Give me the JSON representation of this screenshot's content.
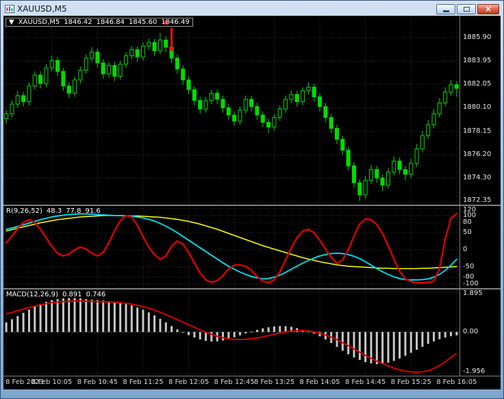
{
  "window": {
    "title": "XAUUSD,M5",
    "buttons": {
      "close_glyph": "×"
    }
  },
  "main_panel": {
    "collapse_arrow": "▼",
    "symbol": "XAUUSD,M5",
    "open": "1846.42",
    "high": "1846.84",
    "low": "1845.60",
    "close": "1846.49"
  },
  "oscillator_panel": {
    "label": "R(9,26,52)",
    "value1": "48.3",
    "value2": "77.8",
    "value3": "91.6"
  },
  "macd_panel": {
    "label": "MACD(12,26,9)",
    "value_main": "0.891",
    "value_signal": "0.746"
  },
  "time_axis": {
    "labels": [
      "8 Feb 2023",
      "8 Feb 10:05",
      "8 Feb 10:45",
      "8 Feb 11:25",
      "8 Feb 12:05",
      "8 Feb 12:45",
      "8 Feb 13:25",
      "8 Feb 14:05",
      "8 Feb 14:45",
      "8 Feb 15:25",
      "8 Feb 16:05"
    ]
  },
  "colors": {
    "background": "#000000",
    "grid": "#333333",
    "candle": "#00DD00",
    "separator": "#808080",
    "osc_fast": "#DD0000",
    "osc_mid": "#00D4E4",
    "osc_slow": "#FFFF00",
    "macd_histogram": "#C8C8C8",
    "macd_signal": "#D40000",
    "annotation": "#FF1010"
  },
  "chart_data": [
    {
      "type": "candlestick",
      "panel": "main",
      "symbol": "XAUUSD,M5",
      "timeframe": "M5",
      "price_range": [
        1872.1,
        1887.7
      ],
      "axis_labels": [
        {
          "v": 1885.9,
          "t": "1885.90"
        },
        {
          "v": 1883.95,
          "t": "1883.95"
        },
        {
          "v": 1882.05,
          "t": "1882.05"
        },
        {
          "v": 1880.1,
          "t": "1880.10"
        },
        {
          "v": 1878.15,
          "t": "1878.15"
        },
        {
          "v": 1876.2,
          "t": "1876.20"
        },
        {
          "v": 1874.3,
          "t": "1874.30"
        },
        {
          "v": 1872.35,
          "t": "1872.35"
        }
      ],
      "candles": [
        [
          1879.2,
          1879.9,
          1878.8,
          1879.6
        ],
        [
          1879.6,
          1880.7,
          1879.3,
          1880.4
        ],
        [
          1880.4,
          1881.5,
          1880.1,
          1881.1
        ],
        [
          1881.1,
          1881.4,
          1880.2,
          1880.6
        ],
        [
          1880.6,
          1882.2,
          1880.3,
          1881.9
        ],
        [
          1881.9,
          1883.1,
          1881.6,
          1882.8
        ],
        [
          1882.8,
          1883.1,
          1881.7,
          1882.1
        ],
        [
          1882.1,
          1883.7,
          1881.8,
          1883.4
        ],
        [
          1883.4,
          1884.4,
          1883.1,
          1884.0
        ],
        [
          1884.0,
          1884.3,
          1882.7,
          1883.1
        ],
        [
          1883.1,
          1883.4,
          1881.5,
          1881.9
        ],
        [
          1881.9,
          1882.2,
          1880.9,
          1881.3
        ],
        [
          1881.3,
          1882.7,
          1881.0,
          1882.4
        ],
        [
          1882.4,
          1883.5,
          1882.1,
          1883.2
        ],
        [
          1883.2,
          1884.5,
          1882.9,
          1884.2
        ],
        [
          1884.2,
          1885.1,
          1883.9,
          1884.7
        ],
        [
          1884.7,
          1885.0,
          1883.4,
          1883.8
        ],
        [
          1883.8,
          1884.1,
          1882.5,
          1882.9
        ],
        [
          1882.9,
          1883.9,
          1882.6,
          1883.6
        ],
        [
          1883.6,
          1883.9,
          1882.3,
          1882.7
        ],
        [
          1882.7,
          1884.0,
          1882.4,
          1883.7
        ],
        [
          1883.7,
          1884.7,
          1883.4,
          1884.4
        ],
        [
          1884.4,
          1885.2,
          1884.1,
          1884.9
        ],
        [
          1884.9,
          1885.2,
          1883.9,
          1884.3
        ],
        [
          1884.3,
          1885.5,
          1884.0,
          1885.2
        ],
        [
          1885.2,
          1885.8,
          1884.9,
          1885.5
        ],
        [
          1885.5,
          1885.8,
          1884.4,
          1884.8
        ],
        [
          1884.8,
          1886.3,
          1884.5,
          1885.7
        ],
        [
          1885.7,
          1886.0,
          1884.7,
          1885.1
        ],
        [
          1885.1,
          1885.4,
          1883.8,
          1884.2
        ],
        [
          1884.2,
          1884.5,
          1882.9,
          1883.3
        ],
        [
          1883.3,
          1883.6,
          1882.0,
          1882.4
        ],
        [
          1882.4,
          1882.7,
          1881.2,
          1881.6
        ],
        [
          1881.6,
          1881.9,
          1880.3,
          1880.7
        ],
        [
          1880.7,
          1881.0,
          1879.6,
          1880.0
        ],
        [
          1880.0,
          1881.0,
          1879.7,
          1880.7
        ],
        [
          1880.7,
          1881.6,
          1880.4,
          1881.3
        ],
        [
          1881.3,
          1881.6,
          1880.4,
          1880.8
        ],
        [
          1880.8,
          1881.1,
          1879.7,
          1880.1
        ],
        [
          1880.1,
          1880.4,
          1879.1,
          1879.5
        ],
        [
          1879.5,
          1879.8,
          1878.6,
          1879.0
        ],
        [
          1879.0,
          1880.2,
          1878.7,
          1879.9
        ],
        [
          1879.9,
          1881.1,
          1879.6,
          1880.8
        ],
        [
          1880.8,
          1881.1,
          1879.8,
          1880.2
        ],
        [
          1880.2,
          1880.5,
          1879.1,
          1879.5
        ],
        [
          1879.5,
          1879.8,
          1878.5,
          1878.9
        ],
        [
          1878.9,
          1879.2,
          1878.0,
          1878.5
        ],
        [
          1878.5,
          1879.6,
          1878.2,
          1879.3
        ],
        [
          1879.3,
          1880.3,
          1879.0,
          1880.0
        ],
        [
          1880.0,
          1881.1,
          1879.7,
          1880.8
        ],
        [
          1880.8,
          1881.5,
          1880.5,
          1881.2
        ],
        [
          1881.2,
          1881.5,
          1880.2,
          1880.6
        ],
        [
          1880.6,
          1881.8,
          1880.3,
          1881.5
        ],
        [
          1881.5,
          1882.2,
          1881.2,
          1881.8
        ],
        [
          1881.8,
          1882.1,
          1880.6,
          1881.0
        ],
        [
          1881.0,
          1881.3,
          1879.8,
          1880.2
        ],
        [
          1880.2,
          1880.5,
          1878.9,
          1879.3
        ],
        [
          1879.3,
          1879.6,
          1878.0,
          1878.4
        ],
        [
          1878.4,
          1878.7,
          1877.1,
          1877.5
        ],
        [
          1877.5,
          1877.8,
          1876.2,
          1876.6
        ],
        [
          1876.6,
          1876.9,
          1874.9,
          1875.3
        ],
        [
          1875.3,
          1875.6,
          1873.5,
          1873.9
        ],
        [
          1873.9,
          1874.2,
          1872.4,
          1872.9
        ],
        [
          1872.9,
          1874.5,
          1872.6,
          1874.1
        ],
        [
          1874.1,
          1875.4,
          1873.8,
          1875.0
        ],
        [
          1875.0,
          1875.3,
          1873.9,
          1874.3
        ],
        [
          1874.3,
          1874.6,
          1873.2,
          1873.7
        ],
        [
          1873.7,
          1875.1,
          1873.4,
          1874.8
        ],
        [
          1874.8,
          1876.1,
          1874.5,
          1875.7
        ],
        [
          1875.7,
          1876.0,
          1874.6,
          1875.0
        ],
        [
          1875.0,
          1875.3,
          1874.1,
          1874.6
        ],
        [
          1874.6,
          1875.9,
          1874.3,
          1875.5
        ],
        [
          1875.5,
          1877.1,
          1875.2,
          1876.7
        ],
        [
          1876.7,
          1878.2,
          1876.4,
          1877.8
        ],
        [
          1877.8,
          1879.1,
          1877.5,
          1878.7
        ],
        [
          1878.7,
          1880.0,
          1878.4,
          1879.6
        ],
        [
          1879.6,
          1880.9,
          1879.3,
          1880.5
        ],
        [
          1880.5,
          1881.8,
          1880.2,
          1881.4
        ],
        [
          1881.4,
          1882.4,
          1881.1,
          1882.0
        ],
        [
          1882.0,
          1882.3,
          1881.0,
          1881.7
        ]
      ],
      "annotations": [
        {
          "type": "star",
          "index": 28,
          "price": 1886.9
        },
        {
          "type": "arrow-down",
          "index": 29,
          "price_from": 1886.7,
          "price_to": 1884.7
        }
      ]
    },
    {
      "type": "line",
      "panel": "oscillator",
      "label": "R(9,26,52)",
      "values_text": "48.3 77.8 91.6",
      "range": [
        -112,
        128
      ],
      "axis_labels": [
        {
          "v": 120,
          "t": "120"
        },
        {
          "v": 100,
          "t": "100"
        },
        {
          "v": 80,
          "t": "80"
        },
        {
          "v": 50,
          "t": "50"
        },
        {
          "v": 0,
          "t": "0"
        },
        {
          "v": -50,
          "t": "-50"
        },
        {
          "v": -80,
          "t": "-80"
        },
        {
          "v": -100,
          "t": "-100"
        }
      ],
      "series": [
        {
          "name": "slow-line",
          "color": "#FFFF00",
          "width": 1.6,
          "values": [
            55,
            59,
            63,
            67,
            71,
            75,
            79,
            82,
            85,
            88,
            90,
            92,
            94,
            96,
            97,
            98,
            99,
            100,
            100,
            100,
            100,
            100,
            99,
            99,
            98,
            97,
            96,
            95,
            93,
            91,
            89,
            86,
            83,
            79,
            75,
            70,
            65,
            60,
            54,
            48,
            42,
            36,
            30,
            24,
            18,
            12,
            7,
            2,
            -3,
            -8,
            -13,
            -18,
            -23,
            -27,
            -31,
            -35,
            -38,
            -41,
            -44,
            -46,
            -48,
            -49,
            -50,
            -51,
            -52,
            -53,
            -54,
            -54,
            -55,
            -55,
            -55,
            -55,
            -55,
            -54,
            -54,
            -53,
            -52,
            -51,
            -50,
            -49
          ]
        },
        {
          "name": "medium-line",
          "color": "#00D4E4",
          "width": 2,
          "values": [
            60,
            64,
            68,
            73,
            78,
            83,
            88,
            92,
            96,
            99,
            101,
            103,
            104,
            105,
            105,
            104,
            103,
            102,
            101,
            100,
            100,
            99,
            98,
            96,
            93,
            89,
            84,
            77,
            69,
            60,
            50,
            39,
            28,
            17,
            6,
            -5,
            -16,
            -27,
            -38,
            -48,
            -57,
            -65,
            -72,
            -78,
            -82,
            -85,
            -84,
            -80,
            -74,
            -66,
            -57,
            -48,
            -39,
            -31,
            -24,
            -18,
            -14,
            -11,
            -10,
            -11,
            -14,
            -19,
            -26,
            -35,
            -45,
            -55,
            -64,
            -72,
            -79,
            -84,
            -87,
            -88,
            -88,
            -87,
            -85,
            -80,
            -72,
            -60,
            -45,
            -28
          ]
        },
        {
          "name": "fast-line",
          "color": "#DD0000",
          "width": 2.4,
          "values": [
            20,
            40,
            62,
            80,
            88,
            80,
            60,
            35,
            10,
            -10,
            -18,
            -12,
            0,
            8,
            2,
            -10,
            -18,
            -8,
            20,
            55,
            85,
            100,
            96,
            72,
            38,
            8,
            -14,
            -28,
            -18,
            10,
            26,
            16,
            -8,
            -38,
            -68,
            -88,
            -95,
            -90,
            -76,
            -56,
            -45,
            -44,
            -48,
            -60,
            -78,
            -92,
            -96,
            -88,
            -65,
            -30,
            5,
            35,
            55,
            60,
            50,
            28,
            2,
            -22,
            -40,
            -30,
            0,
            40,
            75,
            90,
            88,
            74,
            48,
            12,
            -28,
            -62,
            -85,
            -93,
            -96,
            -96,
            -95,
            -92,
            -55,
            30,
            92,
            105
          ]
        }
      ]
    },
    {
      "type": "macd",
      "panel": "macd",
      "label": "MACD(12,26,9)",
      "main_value": "0.891",
      "signal_value": "0.746",
      "range": [
        -2.06,
        2.0
      ],
      "axis_labels": [
        {
          "v": 1.895,
          "t": "1.895"
        },
        {
          "v": 0,
          "t": "0.00"
        },
        {
          "v": -1.956,
          "t": "-1.956"
        }
      ],
      "histogram": [
        0.45,
        0.6,
        0.75,
        0.9,
        1.05,
        1.2,
        1.32,
        1.42,
        1.5,
        1.55,
        1.58,
        1.6,
        1.6,
        1.58,
        1.55,
        1.52,
        1.5,
        1.48,
        1.45,
        1.42,
        1.38,
        1.32,
        1.25,
        1.15,
        1.05,
        0.92,
        0.78,
        0.62,
        0.45,
        0.28,
        0.12,
        -0.02,
        -0.15,
        -0.26,
        -0.35,
        -0.42,
        -0.45,
        -0.44,
        -0.4,
        -0.33,
        -0.25,
        -0.16,
        -0.07,
        0.02,
        0.1,
        0.17,
        0.22,
        0.26,
        0.28,
        0.27,
        0.24,
        0.18,
        0.1,
        0.02,
        -0.08,
        -0.2,
        -0.35,
        -0.52,
        -0.7,
        -0.88,
        -1.05,
        -1.2,
        -1.32,
        -1.42,
        -1.48,
        -1.52,
        -1.5,
        -1.45,
        -1.36,
        -1.25,
        -1.12,
        -0.98,
        -0.84,
        -0.7,
        -0.56,
        -0.44,
        -0.34,
        -0.26,
        -0.2,
        -0.16
      ],
      "signal": [
        0.85,
        0.92,
        1.0,
        1.08,
        1.15,
        1.22,
        1.28,
        1.33,
        1.38,
        1.41,
        1.43,
        1.45,
        1.46,
        1.46,
        1.45,
        1.44,
        1.43,
        1.42,
        1.41,
        1.4,
        1.38,
        1.35,
        1.31,
        1.26,
        1.2,
        1.12,
        1.03,
        0.93,
        0.82,
        0.7,
        0.58,
        0.46,
        0.34,
        0.22,
        0.1,
        -0.01,
        -0.11,
        -0.2,
        -0.27,
        -0.32,
        -0.35,
        -0.36,
        -0.35,
        -0.32,
        -0.28,
        -0.23,
        -0.17,
        -0.11,
        -0.05,
        0.0,
        0.04,
        0.06,
        0.06,
        0.04,
        0.0,
        -0.06,
        -0.14,
        -0.24,
        -0.36,
        -0.5,
        -0.65,
        -0.8,
        -0.95,
        -1.1,
        -1.24,
        -1.37,
        -1.49,
        -1.6,
        -1.7,
        -1.78,
        -1.84,
        -1.88,
        -1.9,
        -1.88,
        -1.82,
        -1.72,
        -1.58,
        -1.4,
        -1.2,
        -1.0
      ]
    }
  ]
}
